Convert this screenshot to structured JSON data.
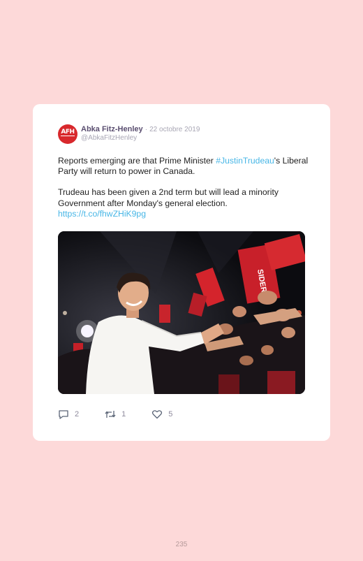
{
  "tweet": {
    "author_name": "Abka Fitz-Henley",
    "separator": "·",
    "date": "22 octobre 2019",
    "handle": "@AbkaFitzHenley",
    "avatar_text": "AFH",
    "paragraph1_before": "Reports emerging are that Prime Minister ",
    "hashtag": "#JustinTrudeau",
    "paragraph1_after": "'s Liberal Party will return to power in Canada.",
    "paragraph2": "Trudeau has been given a 2nd term but will lead a minority Government after Monday's general election.",
    "link": "https://t.co/fhwZHiK9pg",
    "photo_signs": [
      "SIDER"
    ],
    "actions": {
      "replies": "2",
      "retweets": "1",
      "likes": "5"
    },
    "icons": {
      "reply": "speech-bubble-icon",
      "retweet": "retweet-icon",
      "like": "heart-icon"
    }
  },
  "page": {
    "number": "235"
  },
  "colors": {
    "background": "#fdd9d9",
    "card": "#ffffff",
    "link": "#47b6e6",
    "author": "#5a4e70",
    "muted": "#a8a6b4",
    "avatar": "#d8282c"
  }
}
